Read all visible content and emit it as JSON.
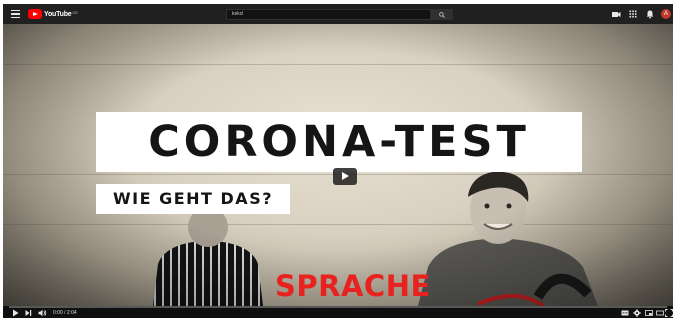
{
  "header": {
    "logo_text": "YouTube",
    "logo_region": "DE",
    "search_value": "kekcl",
    "icons": [
      "menu-icon",
      "create-video-icon",
      "apps-icon",
      "notifications-icon"
    ],
    "avatar_letter": "A",
    "avatar_color": "#c0392b"
  },
  "video": {
    "title": "CORONA-TEST",
    "subtitle": "WIE GEHT DAS?",
    "overlay_word": "SPRACHE",
    "overlay_color": "#e8231f",
    "progress_fraction": 0.0
  },
  "player": {
    "time": "0:00 / 2:04",
    "controls": [
      "play-icon",
      "next-icon",
      "volume-icon"
    ],
    "right_controls": [
      "subtitles-icon",
      "settings-icon",
      "miniplayer-icon",
      "theater-icon",
      "fullscreen-icon"
    ]
  }
}
